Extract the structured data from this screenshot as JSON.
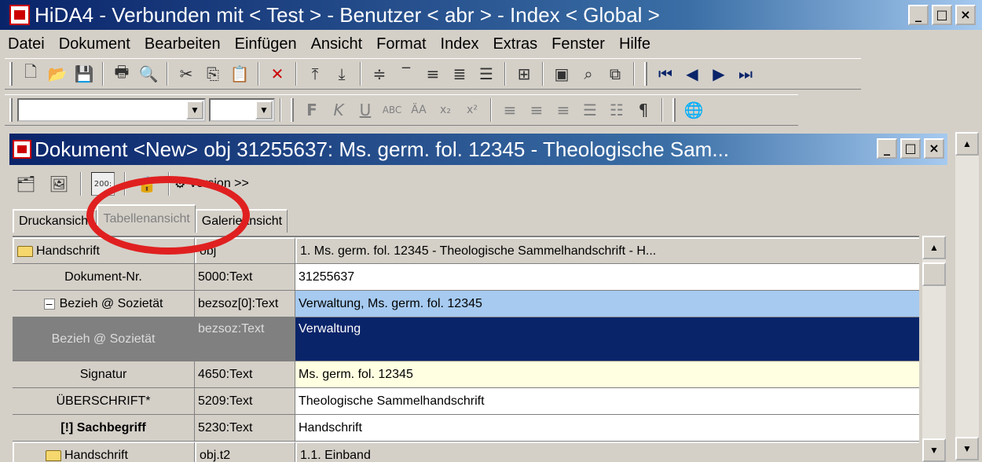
{
  "window": {
    "title": "HiDA4 - Verbunden mit < Test > - Benutzer < abr > - Index < Global >",
    "min": "_",
    "max": "□",
    "close": "×"
  },
  "menu": [
    "Datei",
    "Dokument",
    "Bearbeiten",
    "Einfügen",
    "Ansicht",
    "Format",
    "Index",
    "Extras",
    "Fenster",
    "Hilfe"
  ],
  "toolbar1": {
    "icons": [
      "new-doc",
      "open-folder",
      "save",
      "print",
      "preview",
      "cut",
      "copy",
      "paste",
      "delete",
      "insert-up",
      "insert-down",
      "align-center",
      "align-top",
      "align-middle",
      "align-bottom",
      "list",
      "tree",
      "window",
      "search",
      "window-link",
      "first",
      "prev",
      "next",
      "last"
    ]
  },
  "toolbar2": {
    "format_icons": [
      "F",
      "K",
      "U",
      "ABC",
      "ÄA",
      "x₂",
      "x²",
      "left",
      "center",
      "right",
      "bullets",
      "numbers",
      "¶"
    ]
  },
  "child": {
    "title": "Dokument <New> obj 31255637: Ms. germ. fol. 12345 - Theologische Sam...",
    "version_label": "Version >>",
    "tabs": [
      "Druckansicht",
      "Tabellenansicht",
      "Galerieansicht"
    ]
  },
  "grid": {
    "header": {
      "c1": "Handschrift",
      "c2": "obj",
      "c3": "1. Ms. germ. fol. 12345 - Theologische Sammelhandschrift - H..."
    },
    "rows": [
      {
        "c1": "Dokument-Nr.",
        "c2": "5000:Text",
        "c3": "31255637"
      },
      {
        "c1": "Bezieh @ Sozietät",
        "c2": "bezsoz[0]:Text",
        "c3": "Verwaltung, Ms. germ. fol. 12345"
      },
      {
        "c1": "Bezieh @ Sozietät",
        "c2": "bezsoz:Text",
        "c3": "Verwaltung"
      },
      {
        "c1": "Signatur",
        "c2": "4650:Text",
        "c3": "Ms. germ. fol. 12345"
      },
      {
        "c1": "ÜBERSCHRIFT*",
        "c2": "5209:Text",
        "c3": "Theologische Sammelhandschrift"
      },
      {
        "c1": "[!] Sachbegriff",
        "c2": "5230:Text",
        "c3": "Handschrift"
      },
      {
        "c1": "Handschrift",
        "c2": "obj.t2",
        "c3": "1.1. Einband"
      }
    ]
  }
}
